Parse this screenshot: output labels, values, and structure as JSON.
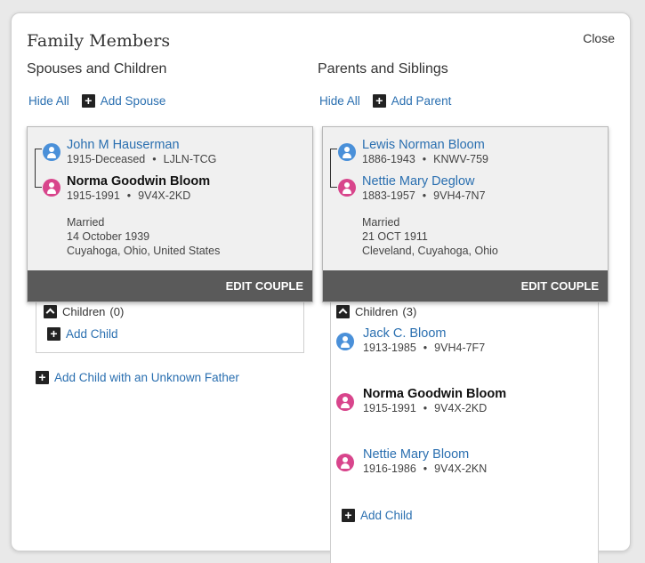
{
  "dialog": {
    "title": "Family Members",
    "close_label": "Close"
  },
  "left": {
    "heading": "Spouses and Children",
    "hide_all": "Hide All",
    "add_label": "Add Spouse",
    "couple": {
      "person1": {
        "name": "John M Hauserman",
        "dates": "1915-Deceased",
        "id": "LJLN-TCG",
        "gender": "male"
      },
      "person2": {
        "name": "Norma Goodwin Bloom",
        "dates": "1915-1991",
        "id": "9V4X-2KD",
        "gender": "female"
      },
      "marriage_label": "Married",
      "marriage_date": "14 October 1939",
      "marriage_place": "Cuyahoga, Ohio, United States",
      "edit_label": "EDIT COUPLE"
    },
    "children_label": "Children",
    "children_count": "(0)",
    "add_child": "Add Child",
    "add_unknown": "Add Child with an Unknown Father"
  },
  "right": {
    "heading": "Parents and Siblings",
    "hide_all": "Hide All",
    "add_label": "Add Parent",
    "couple": {
      "person1": {
        "name": "Lewis Norman Bloom",
        "dates": "1886-1943",
        "id": "KNWV-759",
        "gender": "male"
      },
      "person2": {
        "name": "Nettie Mary Deglow",
        "dates": "1883-1957",
        "id": "9VH4-7N7",
        "gender": "female"
      },
      "marriage_label": "Married",
      "marriage_date": "21 OCT 1911",
      "marriage_place": "Cleveland, Cuyahoga, Ohio",
      "edit_label": "EDIT COUPLE"
    },
    "children_label": "Children",
    "children_count": "(3)",
    "children": [
      {
        "name": "Jack C. Bloom",
        "dates": "1913-1985",
        "id": "9VH4-7F7",
        "gender": "male"
      },
      {
        "name": "Norma Goodwin Bloom",
        "dates": "1915-1991",
        "id": "9V4X-2KD",
        "gender": "female"
      },
      {
        "name": "Nettie Mary Bloom",
        "dates": "1916-1986",
        "id": "9V4X-2KN",
        "gender": "female"
      }
    ],
    "add_child": "Add Child"
  },
  "separator": "•",
  "colors": {
    "link": "#2a6fb0",
    "male": "#4a90d9",
    "female": "#d8458c",
    "edit_bar": "#5a5a5a"
  },
  "icons": {
    "male": "male-person-icon",
    "female": "female-person-icon",
    "add": "plus-icon",
    "collapse": "chevron-up-icon"
  }
}
